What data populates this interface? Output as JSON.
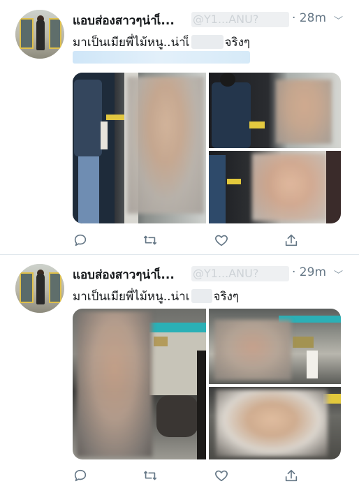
{
  "tweets": [
    {
      "author_name": "แอบส่องสาวๆน่าเ็...",
      "handle_visible": "@Y1...ANU?",
      "time": "· 28m",
      "text_prefix": "มาเป็นเมียพี่ไม้หนู..น่าเ็",
      "text_suffix": "จริงๆ"
    },
    {
      "author_name": "แอบส่องสาวๆน่าเ็...",
      "handle_visible": "@Y1...ANU?",
      "time": "· 29m",
      "text_prefix": "มาเป็นเมียพี่ไม้หนู..น่าเ",
      "text_suffix": "จริงๆ"
    }
  ],
  "colors": {
    "text_primary": "#14171a",
    "text_secondary": "#657786",
    "divider": "#e1e8ed",
    "icon": "#657786"
  },
  "icons": [
    "reply-icon",
    "retweet-icon",
    "like-icon",
    "share-icon",
    "chevron-down-icon"
  ]
}
